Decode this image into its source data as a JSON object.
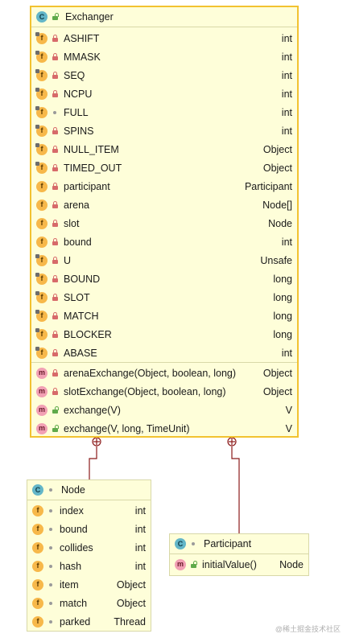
{
  "exchanger": {
    "name": "Exchanger",
    "fields": [
      {
        "name": "ASHIFT",
        "type": "int"
      },
      {
        "name": "MMASK",
        "type": "int"
      },
      {
        "name": "SEQ",
        "type": "int"
      },
      {
        "name": "NCPU",
        "type": "int"
      },
      {
        "name": "FULL",
        "type": "int"
      },
      {
        "name": "SPINS",
        "type": "int"
      },
      {
        "name": "NULL_ITEM",
        "type": "Object"
      },
      {
        "name": "TIMED_OUT",
        "type": "Object"
      },
      {
        "name": "participant",
        "type": "Participant"
      },
      {
        "name": "arena",
        "type": "Node[]"
      },
      {
        "name": "slot",
        "type": "Node"
      },
      {
        "name": "bound",
        "type": "int"
      },
      {
        "name": "U",
        "type": "Unsafe"
      },
      {
        "name": "BOUND",
        "type": "long"
      },
      {
        "name": "SLOT",
        "type": "long"
      },
      {
        "name": "MATCH",
        "type": "long"
      },
      {
        "name": "BLOCKER",
        "type": "long"
      },
      {
        "name": "ABASE",
        "type": "int"
      }
    ],
    "methods": [
      {
        "name": "arenaExchange(Object, boolean, long)",
        "type": "Object"
      },
      {
        "name": "slotExchange(Object, boolean, long)",
        "type": "Object"
      },
      {
        "name": "exchange(V)",
        "type": "V"
      },
      {
        "name": "exchange(V, long, TimeUnit)",
        "type": "V"
      }
    ]
  },
  "node": {
    "name": "Node",
    "fields": [
      {
        "name": "index",
        "type": "int"
      },
      {
        "name": "bound",
        "type": "int"
      },
      {
        "name": "collides",
        "type": "int"
      },
      {
        "name": "hash",
        "type": "int"
      },
      {
        "name": "item",
        "type": "Object"
      },
      {
        "name": "match",
        "type": "Object"
      },
      {
        "name": "parked",
        "type": "Thread"
      }
    ]
  },
  "participant": {
    "name": "Participant",
    "methods": [
      {
        "name": "initialValue()",
        "type": "Node"
      }
    ]
  },
  "icons": {
    "class": "class-icon",
    "field": "field-icon",
    "method": "method-icon",
    "private": "lock-icon",
    "public": "unlock-icon",
    "package": "dot-icon",
    "static_marker": "static-marker"
  },
  "colors": {
    "box_fill": "#fefed9",
    "box_border": "#d8d8a8",
    "selected_border": "#f2c230",
    "connector": "#8b1a1a"
  },
  "watermark": "@稀土掘金技术社区"
}
